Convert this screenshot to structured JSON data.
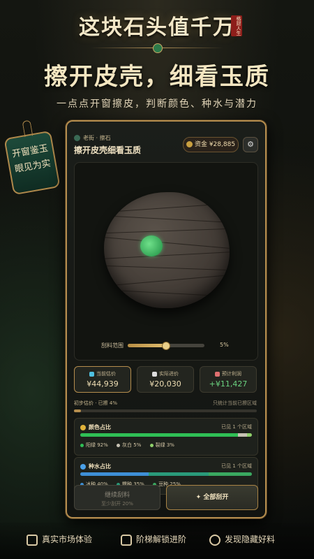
{
  "header": {
    "game_title": "这块石头值千万",
    "seal_text": "格财人生",
    "headline": "擦开皮壳，细看玉质",
    "subline": "一点点开窗擦皮，判断颜色、种水与潜力"
  },
  "tag": {
    "line1": "开窗鉴玉",
    "line2": "眼见为实"
  },
  "panel": {
    "breadcrumb": "老街 · 擦石",
    "stage_title": "擦开皮壳细看玉质",
    "funds_label": "资金",
    "funds_value": "¥28,885",
    "settings_icon": "gear-icon",
    "slider": {
      "label": "刮料范围",
      "value_text": "5%",
      "level": 0.5
    },
    "stats": [
      {
        "label": "当前估价",
        "value": "¥44,939",
        "icon": "diamond-icon",
        "color": "#4fc0e0"
      },
      {
        "label": "实际进价",
        "value": "¥20,030",
        "icon": "document-icon",
        "color": "#dddddd"
      },
      {
        "label": "预计利润",
        "value": "+¥11,427",
        "icon": "chart-icon",
        "color": "#e07070"
      }
    ],
    "estimate": {
      "left": "初步估价 · 已擦 4%",
      "right": "只统计当前已擦区域",
      "progress": 0.04
    },
    "color_box": {
      "title": "颜色占比",
      "note": "已见 1 个区域",
      "segments": [
        {
          "name": "阳绿",
          "percent": 92,
          "color": "#2fbf55"
        },
        {
          "name": "灰白",
          "percent": 5,
          "color": "#c7c2b4"
        },
        {
          "name": "裂绿",
          "percent": 3,
          "color": "#8fd06a"
        }
      ],
      "legend_text": [
        "阳绿 92%",
        "灰白 5%",
        "裂绿 3%"
      ]
    },
    "water_box": {
      "title": "种水占比",
      "note": "已见 1 个区域",
      "segments": [
        {
          "name": "冰种",
          "percent": 40,
          "color": "#3e8fd6"
        },
        {
          "name": "糯种",
          "percent": 35,
          "color": "#2a9a7a"
        },
        {
          "name": "豆种",
          "percent": 25,
          "color": "#3aa860"
        }
      ],
      "legend_text": [
        "冰种 40%",
        "糯种 35%",
        "豆种 25%"
      ]
    },
    "buttons": {
      "continue_label": "继续刮料",
      "continue_sub": "至少刮开 20%",
      "all_label": "全部刮开"
    }
  },
  "footer": {
    "items": [
      {
        "label": "真实市场体验",
        "icon": "shop-icon"
      },
      {
        "label": "阶梯解锁进阶",
        "icon": "lock-icon"
      },
      {
        "label": "发现隐藏好料",
        "icon": "search-icon"
      }
    ]
  }
}
